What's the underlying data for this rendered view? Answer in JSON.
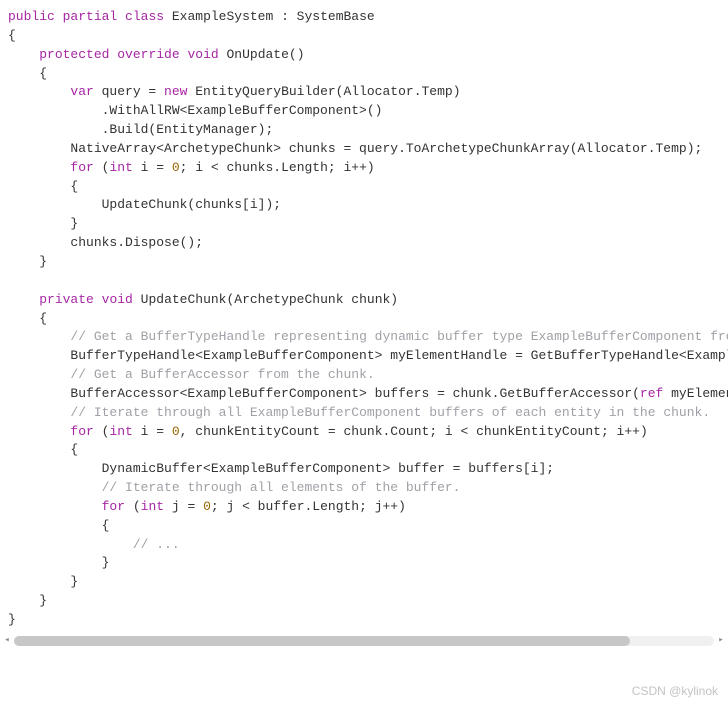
{
  "code": {
    "l01a": "public",
    "l01b": " ",
    "l01c": "partial",
    "l01d": " ",
    "l01e": "class",
    "l01f": " ExampleSystem : SystemBase",
    "l02": "{",
    "l03a": "    ",
    "l03b": "protected",
    "l03c": " ",
    "l03d": "override",
    "l03e": " ",
    "l03f": "void",
    "l03g": " OnUpdate()",
    "l04": "    {",
    "l05a": "        ",
    "l05b": "var",
    "l05c": " query = ",
    "l05d": "new",
    "l05e": " EntityQueryBuilder(Allocator.Temp)",
    "l06": "            .WithAllRW<ExampleBufferComponent>()",
    "l07": "            .Build(EntityManager);",
    "l08": "        NativeArray<ArchetypeChunk> chunks = query.ToArchetypeChunkArray(Allocator.Temp);",
    "l09a": "        ",
    "l09b": "for",
    "l09c": " (",
    "l09d": "int",
    "l09e": " i = ",
    "l09f": "0",
    "l09g": "; i < chunks.Length; i++)",
    "l10": "        {",
    "l11": "            UpdateChunk(chunks[i]);",
    "l12": "        }",
    "l13": "        chunks.Dispose();",
    "l14": "    }",
    "l15": "",
    "l16a": "    ",
    "l16b": "private",
    "l16c": " ",
    "l16d": "void",
    "l16e": " UpdateChunk(ArchetypeChunk chunk)",
    "l17": "    {",
    "l18a": "        ",
    "l18b": "// Get a BufferTypeHandle representing dynamic buffer type ExampleBufferComponent from SystemBase.",
    "l19": "        BufferTypeHandle<ExampleBufferComponent> myElementHandle = GetBufferTypeHandle<ExampleBufferComponent>();",
    "l20a": "        ",
    "l20b": "// Get a BufferAccessor from the chunk.",
    "l21a": "        BufferAccessor<ExampleBufferComponent> buffers = chunk.GetBufferAccessor(",
    "l21b": "ref",
    "l21c": " myElementHandle);",
    "l22a": "        ",
    "l22b": "// Iterate through all ExampleBufferComponent buffers of each entity in the chunk.",
    "l23a": "        ",
    "l23b": "for",
    "l23c": " (",
    "l23d": "int",
    "l23e": " i = ",
    "l23f": "0",
    "l23g": ", chunkEntityCount = chunk.Count; i < chunkEntityCount; i++)",
    "l24": "        {",
    "l25": "            DynamicBuffer<ExampleBufferComponent> buffer = buffers[i];",
    "l26a": "            ",
    "l26b": "// Iterate through all elements of the buffer.",
    "l27a": "            ",
    "l27b": "for",
    "l27c": " (",
    "l27d": "int",
    "l27e": " j = ",
    "l27f": "0",
    "l27g": "; j < buffer.Length; j++)",
    "l28": "            {",
    "l29a": "                ",
    "l29b": "// ...",
    "l30": "            }",
    "l31": "        }",
    "l32": "    }",
    "l33": "}"
  },
  "watermark": "CSDN @kylinok"
}
